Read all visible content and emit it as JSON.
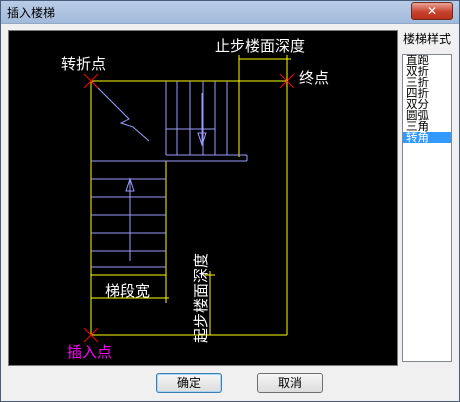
{
  "window": {
    "title": "插入楼梯",
    "close_glyph": "✕"
  },
  "canvas": {
    "turn_point": "转折点",
    "end_point": "终点",
    "insert_point": "插入点",
    "stop_floor_depth": "止步楼面深度",
    "start_floor_depth": "起步楼面深度",
    "flight_width": "梯段宽",
    "colors": {
      "outline": "#ffff00",
      "stairs": "#9a9aff",
      "marker": "#ff0000",
      "insert_text": "#ff00ff",
      "text": "#ffffff"
    }
  },
  "style_list": {
    "label": "楼梯样式",
    "items": [
      "直跑",
      "双折",
      "三折",
      "四折",
      "双分",
      "圆弧",
      "三角",
      "转角"
    ],
    "selected_index": 7
  },
  "buttons": {
    "ok": "确定",
    "cancel": "取消"
  }
}
